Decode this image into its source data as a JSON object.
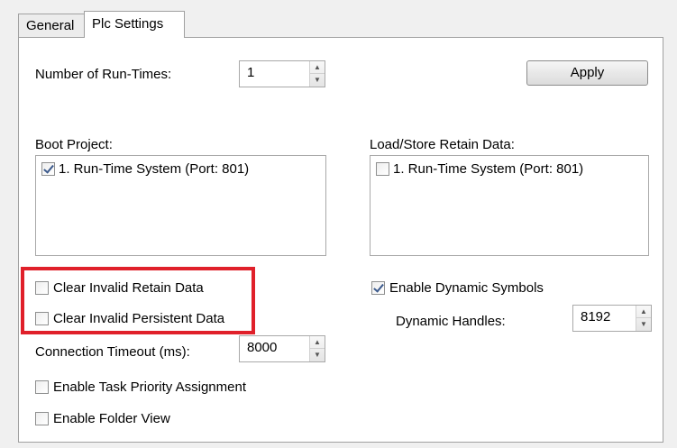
{
  "tabs": [
    {
      "label": "General"
    },
    {
      "label": "Plc Settings"
    }
  ],
  "runtimes": {
    "label": "Number of Run-Times:",
    "value": "1"
  },
  "apply_button": "Apply",
  "boot_project": {
    "label": "Boot Project:",
    "items": [
      {
        "label": "1. Run-Time System (Port: 801)",
        "checked": true
      }
    ]
  },
  "retain_data": {
    "label": "Load/Store Retain Data:",
    "items": [
      {
        "label": "1. Run-Time System (Port: 801)",
        "checked": false
      }
    ]
  },
  "options": {
    "clear_invalid_retain": {
      "label": "Clear Invalid Retain Data",
      "checked": false
    },
    "clear_invalid_persistent": {
      "label": "Clear Invalid Persistent Data",
      "checked": false
    },
    "enable_dynamic_symbols": {
      "label": "Enable Dynamic Symbols",
      "checked": true
    },
    "enable_task_priority": {
      "label": "Enable Task Priority Assignment",
      "checked": false
    },
    "enable_folder_view": {
      "label": "Enable Folder View",
      "checked": false
    }
  },
  "dynamic_handles": {
    "label": "Dynamic Handles:",
    "value": "8192"
  },
  "connection_timeout": {
    "label": "Connection Timeout (ms):",
    "value": "8000"
  },
  "highlight_color": "#e0202a",
  "spin_arrows": {
    "up": "▲",
    "down": "▼"
  }
}
